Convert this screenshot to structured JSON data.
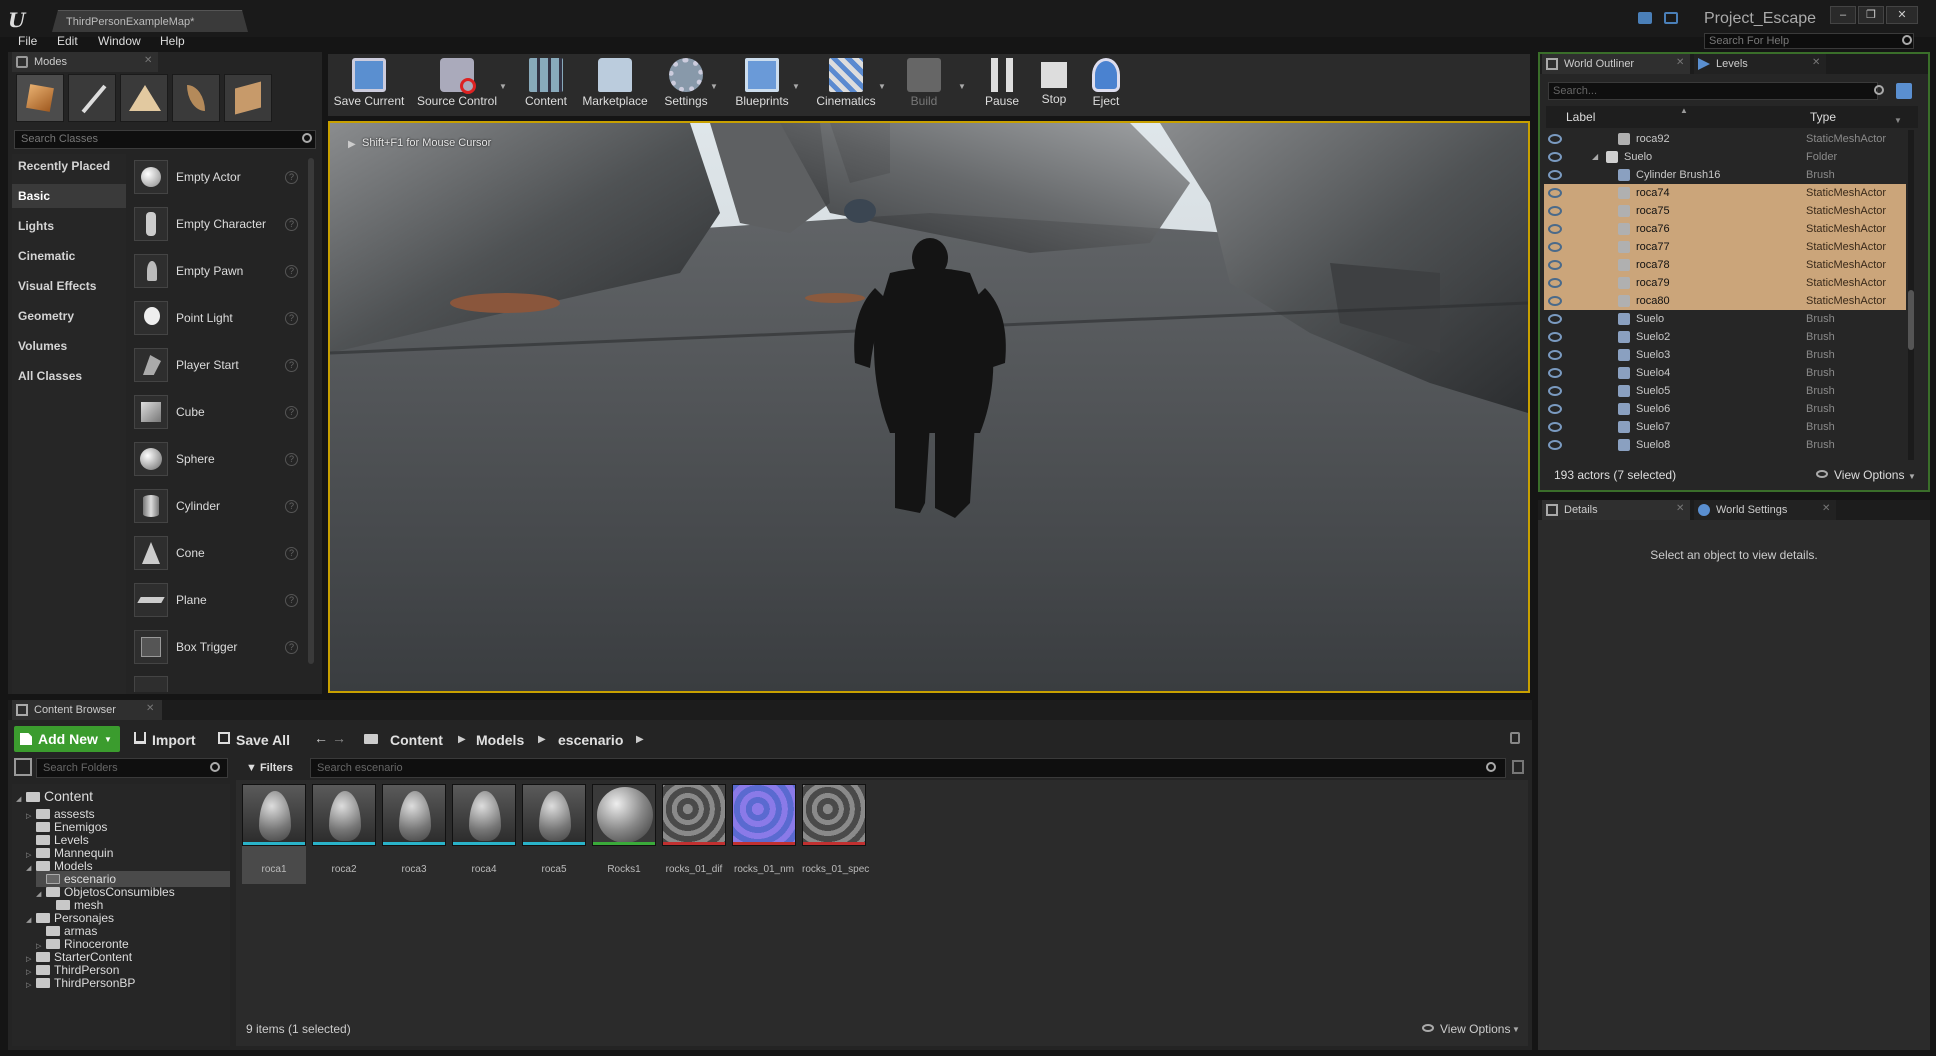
{
  "window": {
    "tab_title": "ThirdPersonExampleMap*",
    "project_name": "Project_Escape",
    "help_search_placeholder": "Search For Help",
    "menu": [
      "File",
      "Edit",
      "Window",
      "Help"
    ]
  },
  "modes": {
    "tab_label": "Modes",
    "search_placeholder": "Search Classes",
    "categories": [
      "Recently Placed",
      "Basic",
      "Lights",
      "Cinematic",
      "Visual Effects",
      "Geometry",
      "Volumes",
      "All Classes"
    ],
    "selected_category": "Basic",
    "classes": [
      "Empty Actor",
      "Empty Character",
      "Empty Pawn",
      "Point Light",
      "Player Start",
      "Cube",
      "Sphere",
      "Cylinder",
      "Cone",
      "Plane",
      "Box Trigger"
    ]
  },
  "toolbar": {
    "buttons": [
      "Save Current",
      "Source Control",
      "Content",
      "Marketplace",
      "Settings",
      "Blueprints",
      "Cinematics",
      "Build",
      "Pause",
      "Stop",
      "Eject"
    ]
  },
  "viewport": {
    "hint": "Shift+F1 for Mouse Cursor"
  },
  "outliner": {
    "tabs": [
      "World Outliner",
      "Levels"
    ],
    "search_placeholder": "Search...",
    "col_label": "Label",
    "col_type": "Type",
    "rows": [
      {
        "label": "roca92",
        "type": "StaticMeshActor",
        "selected": false
      },
      {
        "label": "Suelo",
        "type": "Folder",
        "selected": false
      },
      {
        "label": "Cylinder Brush16",
        "type": "Brush",
        "selected": false
      },
      {
        "label": "roca74",
        "type": "StaticMeshActor",
        "selected": true
      },
      {
        "label": "roca75",
        "type": "StaticMeshActor",
        "selected": true
      },
      {
        "label": "roca76",
        "type": "StaticMeshActor",
        "selected": true
      },
      {
        "label": "roca77",
        "type": "StaticMeshActor",
        "selected": true
      },
      {
        "label": "roca78",
        "type": "StaticMeshActor",
        "selected": true
      },
      {
        "label": "roca79",
        "type": "StaticMeshActor",
        "selected": true
      },
      {
        "label": "roca80",
        "type": "StaticMeshActor",
        "selected": true
      },
      {
        "label": "Suelo",
        "type": "Brush",
        "selected": false
      },
      {
        "label": "Suelo2",
        "type": "Brush",
        "selected": false
      },
      {
        "label": "Suelo3",
        "type": "Brush",
        "selected": false
      },
      {
        "label": "Suelo4",
        "type": "Brush",
        "selected": false
      },
      {
        "label": "Suelo5",
        "type": "Brush",
        "selected": false
      },
      {
        "label": "Suelo6",
        "type": "Brush",
        "selected": false
      },
      {
        "label": "Suelo7",
        "type": "Brush",
        "selected": false
      },
      {
        "label": "Suelo8",
        "type": "Brush",
        "selected": false
      }
    ],
    "status": "193 actors (7 selected)",
    "view_options": "View Options"
  },
  "details": {
    "tabs": [
      "Details",
      "World Settings"
    ],
    "empty_message": "Select an object to view details."
  },
  "content_browser": {
    "tab_label": "Content Browser",
    "add_new": "Add New",
    "import": "Import",
    "save_all": "Save All",
    "path": [
      "Content",
      "Models",
      "escenario"
    ],
    "search_folders_placeholder": "Search Folders",
    "filters": "Filters",
    "search_assets_placeholder": "Search escenario",
    "tree": [
      {
        "label": "Content",
        "depth": 0,
        "root": true
      },
      {
        "label": "assests",
        "depth": 1
      },
      {
        "label": "Enemigos",
        "depth": 1
      },
      {
        "label": "Levels",
        "depth": 1
      },
      {
        "label": "Mannequin",
        "depth": 1
      },
      {
        "label": "Models",
        "depth": 1
      },
      {
        "label": "escenario",
        "depth": 2,
        "selected": true
      },
      {
        "label": "ObjetosConsumibles",
        "depth": 2
      },
      {
        "label": "mesh",
        "depth": 3
      },
      {
        "label": "Personajes",
        "depth": 1
      },
      {
        "label": "armas",
        "depth": 2
      },
      {
        "label": "Rinoceronte",
        "depth": 2
      },
      {
        "label": "StarterContent",
        "depth": 1
      },
      {
        "label": "ThirdPerson",
        "depth": 1
      },
      {
        "label": "ThirdPersonBP",
        "depth": 1
      }
    ],
    "assets": [
      {
        "label": "roca1",
        "kind": "mesh",
        "selected": true
      },
      {
        "label": "roca2",
        "kind": "mesh"
      },
      {
        "label": "roca3",
        "kind": "mesh"
      },
      {
        "label": "roca4",
        "kind": "mesh"
      },
      {
        "label": "roca5",
        "kind": "mesh"
      },
      {
        "label": "Rocks1",
        "kind": "material"
      },
      {
        "label": "rocks_01_dif",
        "kind": "texture"
      },
      {
        "label": "rocks_01_nm",
        "kind": "texture"
      },
      {
        "label": "rocks_01_spec",
        "kind": "texture"
      }
    ],
    "status": "9 items (1 selected)",
    "view_options": "View Options"
  },
  "colors": {
    "selection": "#cba57a",
    "viewport_border": "#c8a000",
    "add_new_green": "#3b9c2e",
    "mesh_line": "#2ab3c9",
    "material_line": "#3aaa3a",
    "texture_line": "#c03030"
  }
}
